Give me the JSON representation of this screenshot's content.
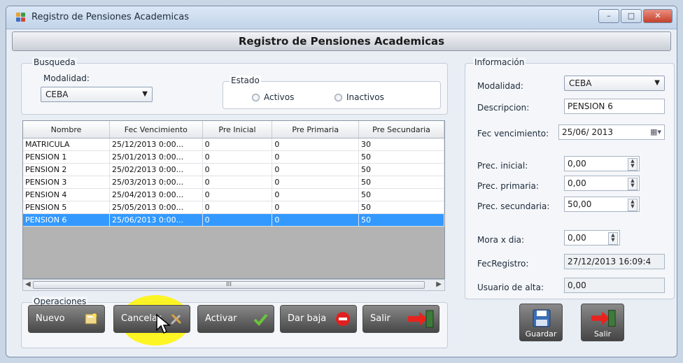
{
  "window": {
    "title": "Registro de Pensiones Academicas"
  },
  "header": {
    "title": "Registro de Pensiones Academicas"
  },
  "search": {
    "title": "Busqueda",
    "modalidad_label": "Modalidad:",
    "modalidad_value": "CEBA",
    "estado_label": "Estado",
    "activos_label": "Activos",
    "inactivos_label": "Inactivos"
  },
  "grid": {
    "columns": [
      "Nombre",
      "Fec Vencimiento",
      "Pre Inicial",
      "Pre Primaria",
      "Pre Secundaria"
    ],
    "rows": [
      [
        "MATRICULA",
        "25/12/2013 0:00...",
        "0",
        "0",
        "30"
      ],
      [
        "PENSION 1",
        "25/01/2013 0:00...",
        "0",
        "0",
        "50"
      ],
      [
        "PENSION 2",
        "25/02/2013 0:00...",
        "0",
        "0",
        "50"
      ],
      [
        "PENSION 3",
        "25/03/2013 0:00...",
        "0",
        "0",
        "50"
      ],
      [
        "PENSION 4",
        "25/04/2013 0:00...",
        "0",
        "0",
        "50"
      ],
      [
        "PENSION 5",
        "25/05/2013 0:00...",
        "0",
        "0",
        "50"
      ],
      [
        "PENSION 6",
        "25/06/2013 0:00...",
        "0",
        "0",
        "50"
      ]
    ],
    "selected_row": 6,
    "scroll_grip": "III"
  },
  "operations": {
    "title": "Operaciones",
    "nuevo": "Nuevo",
    "cancelar": "Cancelar",
    "activar": "Activar",
    "dar_baja": "Dar baja",
    "salir": "Salir"
  },
  "info": {
    "title": "Información",
    "modalidad_label": "Modalidad:",
    "modalidad_value": "CEBA",
    "descripcion_label": "Descripcion:",
    "descripcion_value": "PENSION 6",
    "fec_vencimiento_label": "Fec vencimiento:",
    "fec_vencimiento_value": "25/06/ 2013",
    "prec_inicial_label": "Prec. inicial:",
    "prec_inicial_value": "0,00",
    "prec_primaria_label": "Prec. primaria:",
    "prec_primaria_value": "0,00",
    "prec_secundaria_label": "Prec. secundaria:",
    "prec_secundaria_value": "50,00",
    "mora_label": "Mora x dia:",
    "mora_value": "0,00",
    "fecregistro_label": "FecRegistro:",
    "fecregistro_value": "27/12/2013 16:09:4",
    "usuario_label": "Usuario de alta:",
    "usuario_value": "0,00",
    "guardar": "Guardar",
    "salir": "Salir"
  }
}
